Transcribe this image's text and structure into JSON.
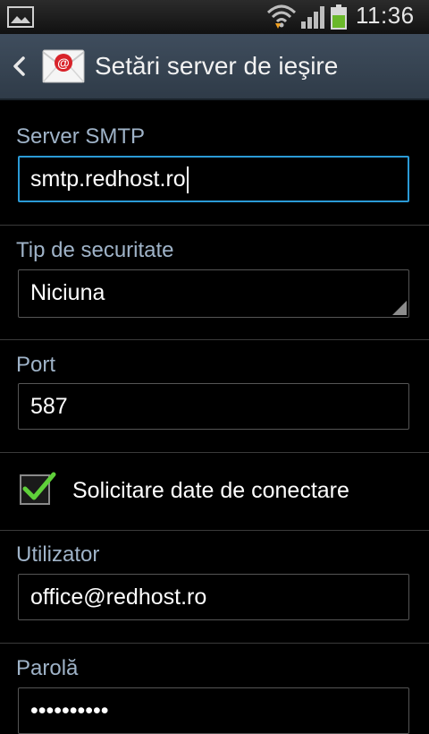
{
  "status_bar": {
    "time": "11:36",
    "icons": [
      "gallery-icon",
      "wifi-icon",
      "signal-icon",
      "battery-icon"
    ],
    "battery_color": "#6ab82a"
  },
  "action_bar": {
    "title": "Setări server de ieşire",
    "back_icon": "chevron-left-icon",
    "app_icon": "email-app-icon"
  },
  "form": {
    "smtp_server": {
      "label": "Server SMTP",
      "value": "smtp.redhost.ro"
    },
    "security_type": {
      "label": "Tip de securitate",
      "value": "Niciuna"
    },
    "port": {
      "label": "Port",
      "value": "587"
    },
    "require_login": {
      "label": "Solicitare date de conectare",
      "checked": true
    },
    "username": {
      "label": "Utilizator",
      "value": "office@redhost.ro"
    },
    "password": {
      "label": "Parolă",
      "value": "••••••••••"
    }
  },
  "colors": {
    "accent": "#2b9ad6",
    "label": "#9fb3c8",
    "checkmark": "#5fd03a",
    "action_bar": "#3a4757"
  }
}
